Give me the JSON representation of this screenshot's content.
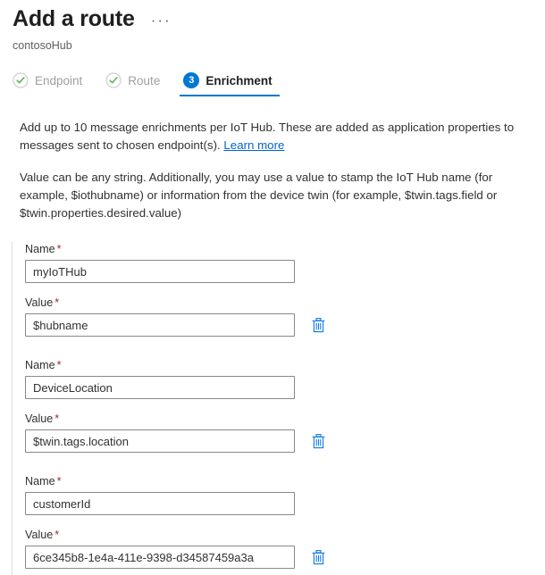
{
  "header": {
    "title": "Add a route",
    "subtitle": "contosoHub",
    "more_options": "···"
  },
  "steps": [
    {
      "label": "Endpoint",
      "state": "completed",
      "icon": "check-circle-icon",
      "number": "1"
    },
    {
      "label": "Route",
      "state": "completed",
      "icon": "check-circle-icon",
      "number": "2"
    },
    {
      "label": "Enrichment",
      "state": "current",
      "icon": "step-number-badge",
      "number": "3"
    }
  ],
  "description": {
    "paragraph1_before_link": "Add up to 10 message enrichments per IoT Hub. These are added as application properties to messages sent to chosen endpoint(s). ",
    "learn_more": "Learn more",
    "paragraph2": "Value can be any string. Additionally, you may use a value to stamp the IoT Hub name (for example, $iothubname) or information from the device twin (for example, $twin.tags.field or $twin.properties.desired.value)"
  },
  "form": {
    "name_label": "Name",
    "value_label": "Value",
    "required_marker": "*",
    "delete_icon": "trash-icon",
    "enrichments": [
      {
        "name": "myIoTHub",
        "value": "$hubname"
      },
      {
        "name": "DeviceLocation",
        "value": "$twin.tags.location"
      },
      {
        "name": "customerId",
        "value": "6ce345b8-1e4a-411e-9398-d34587459a3a"
      }
    ]
  },
  "colors": {
    "accent": "#0078d4",
    "link": "#0066cc",
    "required": "#a4262c",
    "checkmark": "#5ab55a",
    "disabled_text": "#a19f9d",
    "trash": "#0f7ae5"
  }
}
